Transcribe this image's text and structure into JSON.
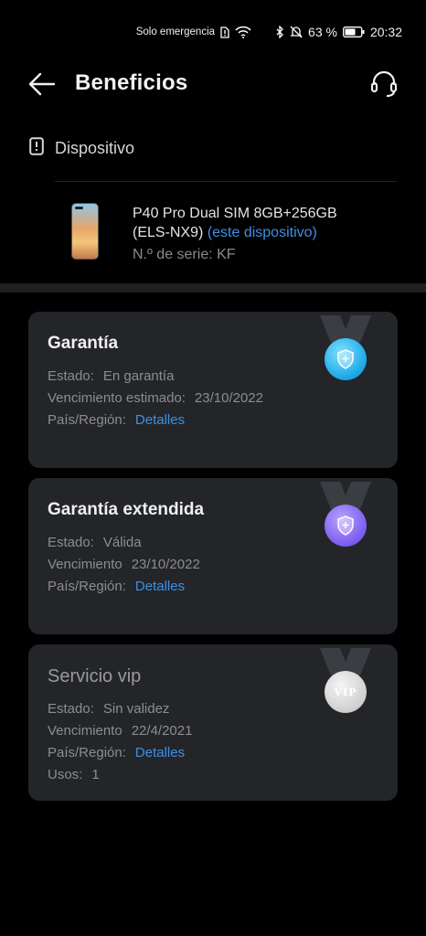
{
  "status_bar": {
    "network_text": "Solo emergencia",
    "battery_percent": "63 %",
    "time": "20:32",
    "icons": [
      "sim-alert-icon",
      "wifi-icon",
      "bluetooth-icon",
      "mute-icon",
      "battery-icon"
    ]
  },
  "header": {
    "title": "Beneficios",
    "back_icon": "back-arrow-icon",
    "support_icon": "headset-icon"
  },
  "device_section": {
    "label": "Dispositivo",
    "device": {
      "name": "P40 Pro Dual SIM 8GB+256GB",
      "model": "(ELS-NX9)",
      "this_device_label": "(este dispositivo)",
      "serial_label": "N.º de serie:",
      "serial_value": "KF"
    }
  },
  "cards": {
    "warranty": {
      "title": "Garantía",
      "status_label": "Estado:",
      "status_value": "En garantía",
      "expiry_label": "Vencimiento estimado:",
      "expiry_value": "23/10/2022",
      "region_label": "País/Región:",
      "region_link": "Detalles",
      "medal_color": "#1aa6e8"
    },
    "extended": {
      "title": "Garantía extendida",
      "status_label": "Estado:",
      "status_value": "Válida",
      "expiry_label": "Vencimiento",
      "expiry_value": "23/10/2022",
      "region_label": "País/Región:",
      "region_link": "Detalles",
      "medal_color": "#7a5cf0"
    },
    "vip": {
      "title": "Servicio vip",
      "status_label": "Estado:",
      "status_value": "Sin validez",
      "expiry_label": "Vencimiento",
      "expiry_value": "22/4/2021",
      "region_label": "País/Región:",
      "region_link": "Detalles",
      "uses_label": "Usos:",
      "uses_value": "1",
      "medal_text": "VIP",
      "medal_color": "#cfcfcf"
    }
  },
  "colors": {
    "background": "#000000",
    "card": "#232528",
    "link": "#3f8fe6"
  }
}
